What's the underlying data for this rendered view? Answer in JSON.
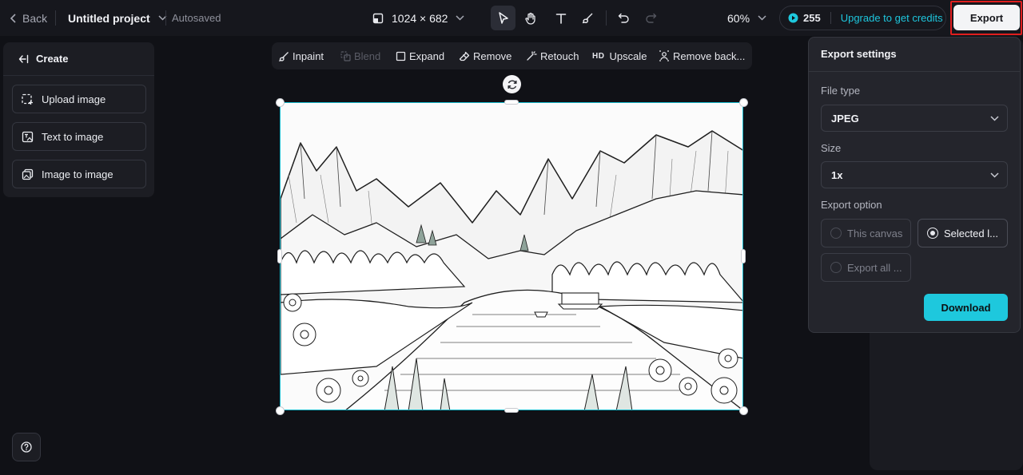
{
  "header": {
    "back_label": "Back",
    "project_title": "Untitled project",
    "autosave_status": "Autosaved",
    "canvas_size": "1024 × 682",
    "zoom": "60%",
    "credits": "255",
    "upgrade_label": "Upgrade to get credits",
    "export_label": "Export",
    "accent_color": "#1ec8dd",
    "highlight_color": "#e01e1e"
  },
  "left_panel": {
    "title": "Create",
    "items": [
      {
        "label": "Upload image",
        "icon": "upload-image-icon"
      },
      {
        "label": "Text to image",
        "icon": "text-to-image-icon"
      },
      {
        "label": "Image to image",
        "icon": "image-to-image-icon"
      }
    ]
  },
  "image_toolbar": {
    "items": [
      {
        "label": "Inpaint",
        "icon": "brush-icon",
        "enabled": true
      },
      {
        "label": "Blend",
        "icon": "blend-icon",
        "enabled": false
      },
      {
        "label": "Expand",
        "icon": "expand-icon",
        "enabled": true
      },
      {
        "label": "Remove",
        "icon": "eraser-icon",
        "enabled": true
      },
      {
        "label": "Retouch",
        "icon": "magic-wand-icon",
        "enabled": true
      },
      {
        "label": "Upscale",
        "icon": "hd-icon",
        "enabled": true
      },
      {
        "label": "Remove back...",
        "icon": "remove-background-icon",
        "enabled": true
      }
    ],
    "hd_badge": "HD"
  },
  "export_settings": {
    "title": "Export settings",
    "file_type_label": "File type",
    "file_type_value": "JPEG",
    "size_label": "Size",
    "size_value": "1x",
    "export_option_label": "Export option",
    "options": [
      {
        "label": "This canvas",
        "selected": false
      },
      {
        "label": "Selected l...",
        "selected": true
      },
      {
        "label": "Export all ...",
        "selected": false
      }
    ],
    "download_label": "Download"
  }
}
